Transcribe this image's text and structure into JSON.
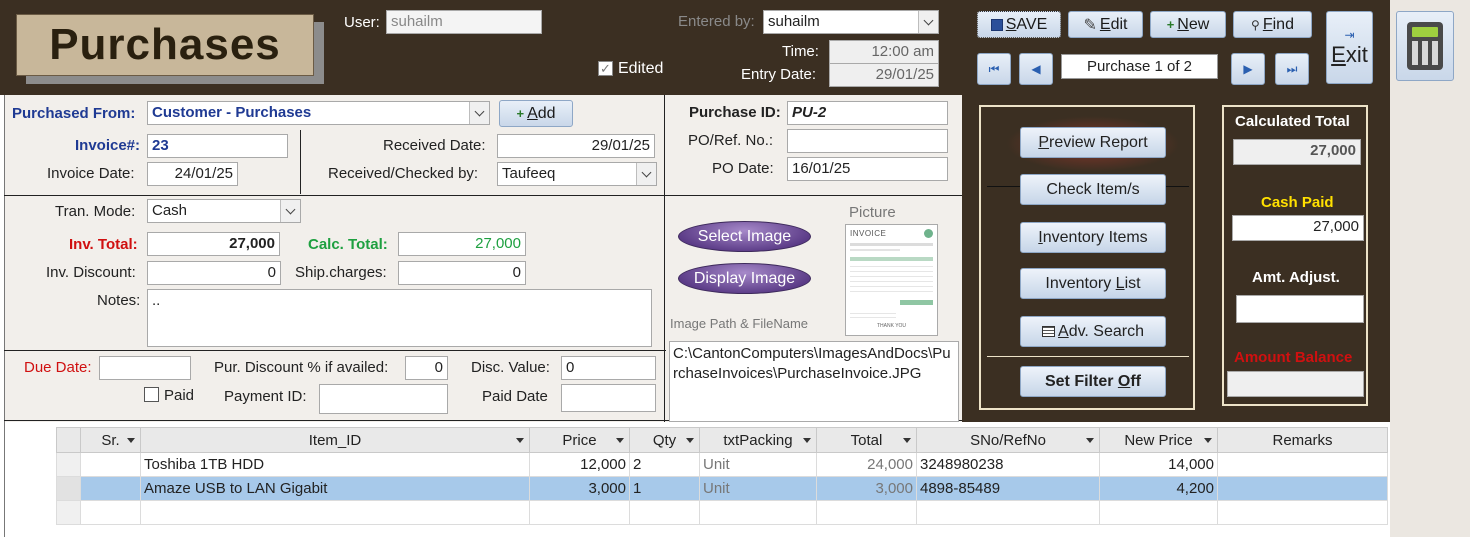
{
  "header": {
    "title": "Purchases",
    "user_label": "User:",
    "user_value": "suhailm",
    "entered_by_label": "Entered by:",
    "entered_by_value": "suhailm",
    "time_label": "Time:",
    "time_value": "12:00 am",
    "entry_date_label": "Entry Date:",
    "entry_date_value": "29/01/25",
    "edited_label": "Edited",
    "edited_checked": true
  },
  "toolbar": {
    "save_prefix": "",
    "save_label_u": "S",
    "save_label_rest": "AVE",
    "edit_u": "E",
    "edit_rest": "dit",
    "new_u": "N",
    "new_rest": "ew",
    "find_u": "F",
    "find_rest": "ind",
    "exit_u": "E",
    "exit_rest": "xit",
    "record_position": "Purchase 1 of 2"
  },
  "form": {
    "purchased_from_label": "Purchased From:",
    "purchased_from_value": "Customer - Purchases",
    "add_u": "A",
    "add_rest": "dd",
    "invoice_no_label": "Invoice#:",
    "invoice_no_value": "23",
    "invoice_date_label": "Invoice Date:",
    "invoice_date_value": "24/01/25",
    "received_date_label": "Received Date:",
    "received_date_value": "29/01/25",
    "received_by_label": "Received/Checked by:",
    "received_by_value": "Taufeeq",
    "purchase_id_label": "Purchase ID:",
    "purchase_id_value": "PU-2",
    "po_ref_label": "PO/Ref. No.:",
    "po_ref_value": "",
    "po_date_label": "PO  Date:",
    "po_date_value": "16/01/25",
    "tran_mode_label": "Tran. Mode:",
    "tran_mode_value": "Cash",
    "inv_total_label": "Inv. Total:",
    "inv_total_value": "27,000",
    "calc_total_label": "Calc. Total:",
    "calc_total_value": "27,000",
    "inv_discount_label": "Inv. Discount:",
    "inv_discount_value": "0",
    "ship_charges_label": "Ship.charges:",
    "ship_charges_value": "0",
    "notes_label": "Notes:",
    "notes_value": "..",
    "due_date_label": "Due Date:",
    "due_date_value": "",
    "pur_discount_label": "Pur. Discount % if availed:",
    "pur_discount_value": "0",
    "disc_value_label": "Disc. Value:",
    "disc_value_value": "0",
    "paid_label": "Paid",
    "paid_checked": false,
    "payment_id_label": "Payment ID:",
    "payment_id_value": "",
    "paid_date_label": "Paid Date",
    "paid_date_value": ""
  },
  "image_section": {
    "select_image": "Select Image",
    "display_image": "Display Image",
    "picture_label": "Picture",
    "thumbnail_text": "INVOICE",
    "thumbnail_footer": "THANK YOU",
    "path_label": "Image Path & FileName",
    "path_value": "C:\\CantonComputers\\ImagesAndDocs\\PurchaseInvoices\\PurchaseInvoice.JPG"
  },
  "actions": {
    "preview_report_u": "P",
    "preview_report_rest": "review Report",
    "check_items": "Check Item/s",
    "inventory_items_u": "I",
    "inventory_items_rest": "nventory Items",
    "inventory_list_pre": "Inventory ",
    "inventory_list_u": "L",
    "inventory_list_rest": "ist",
    "adv_search_u": "A",
    "adv_search_rest": "dv. Search",
    "set_filter_pre": "Set Filter ",
    "set_filter_u": "O",
    "set_filter_rest": "ff"
  },
  "totals": {
    "calculated_total_label": "Calculated Total",
    "calculated_total_value": "27,000",
    "cash_paid_label": "Cash Paid",
    "cash_paid_value": "27,000",
    "amt_adjust_label": "Amt. Adjust.",
    "amt_adjust_value": "",
    "amount_balance_label": "Amount Balance",
    "amount_balance_value": ""
  },
  "grid": {
    "columns": [
      "Sr.",
      "Item_ID",
      "Price",
      "Qty",
      "txtPacking",
      "Total",
      "SNo/RefNo",
      "New Price",
      "Remarks"
    ],
    "rows": [
      {
        "sr": "",
        "item_id": "Toshiba 1TB HDD",
        "price": "12,000",
        "qty": "2",
        "packing": "Unit",
        "total": "24,000",
        "sno": "3248980238",
        "new_price": "14,000",
        "remarks": ""
      },
      {
        "sr": "",
        "item_id": "Amaze USB to LAN Gigabit",
        "price": "3,000",
        "qty": "1",
        "packing": "Unit",
        "total": "3,000",
        "sno": "4898-85489",
        "new_price": "4,200",
        "remarks": ""
      }
    ]
  },
  "colors": {
    "header_bg": "#3b2f22",
    "title_box": "#c8b79a",
    "label_blue": "#1f3a93",
    "label_red": "#d01010",
    "label_green": "#1ea040",
    "cash_paid_yellow": "#ffe000",
    "selected_row": "#a7c9ea"
  }
}
